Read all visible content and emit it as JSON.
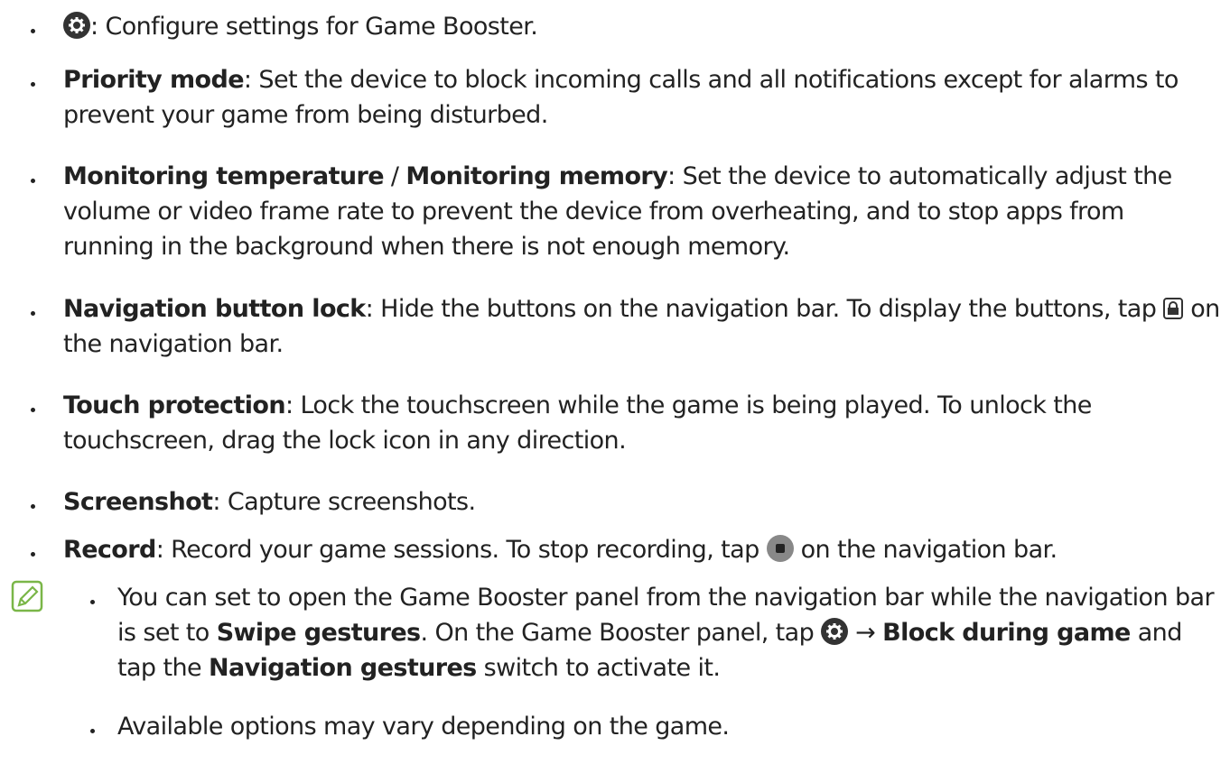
{
  "items": [
    {
      "name": "",
      "desc": ": Configure settings for Game Booster."
    },
    {
      "name": "Priority mode",
      "desc": ": Set the device to block incoming calls and all notifications except for alarms to prevent your game from being disturbed."
    },
    {
      "name": "Monitoring temperature",
      "sep": " / ",
      "name2": "Monitoring memory",
      "desc": ": Set the device to automatically adjust the volume or video frame rate to prevent the device from overheating, and to stop apps from running in the background when there is not enough memory."
    },
    {
      "name": "Navigation button lock",
      "desc1": ": Hide the buttons on the navigation bar. To display the buttons, tap",
      "desc2": "on the navigation bar."
    },
    {
      "name": "Touch protection",
      "desc": ": Lock the touchscreen while the game is being played. To unlock the touchscreen, drag the lock icon in any direction."
    },
    {
      "name": "Screenshot",
      "desc": ": Capture screenshots."
    },
    {
      "name": "Record",
      "desc1": ": Record your game sessions. To stop recording, tap",
      "desc2": "on the navigation bar."
    }
  ],
  "notes": [
    {
      "t1": "You can set to open the Game Booster panel from the navigation bar while the navigation bar is set to",
      "b1": "Swipe gestures",
      "t2": ". On the Game Booster panel, tap",
      "arrow": "→",
      "b2": "Block during game",
      "t3": "and tap the",
      "b3": "Navigation gestures",
      "t4": "switch to activate it."
    },
    {
      "t1": "Available options may vary depending on the game."
    }
  ],
  "icons": {
    "settings": "gear-icon",
    "lock": "navigation-lock-icon",
    "stop": "stop-recording-icon",
    "note": "note-pencil-icon"
  },
  "colors": {
    "note_icon": "#7ab648",
    "text": "#222222"
  }
}
